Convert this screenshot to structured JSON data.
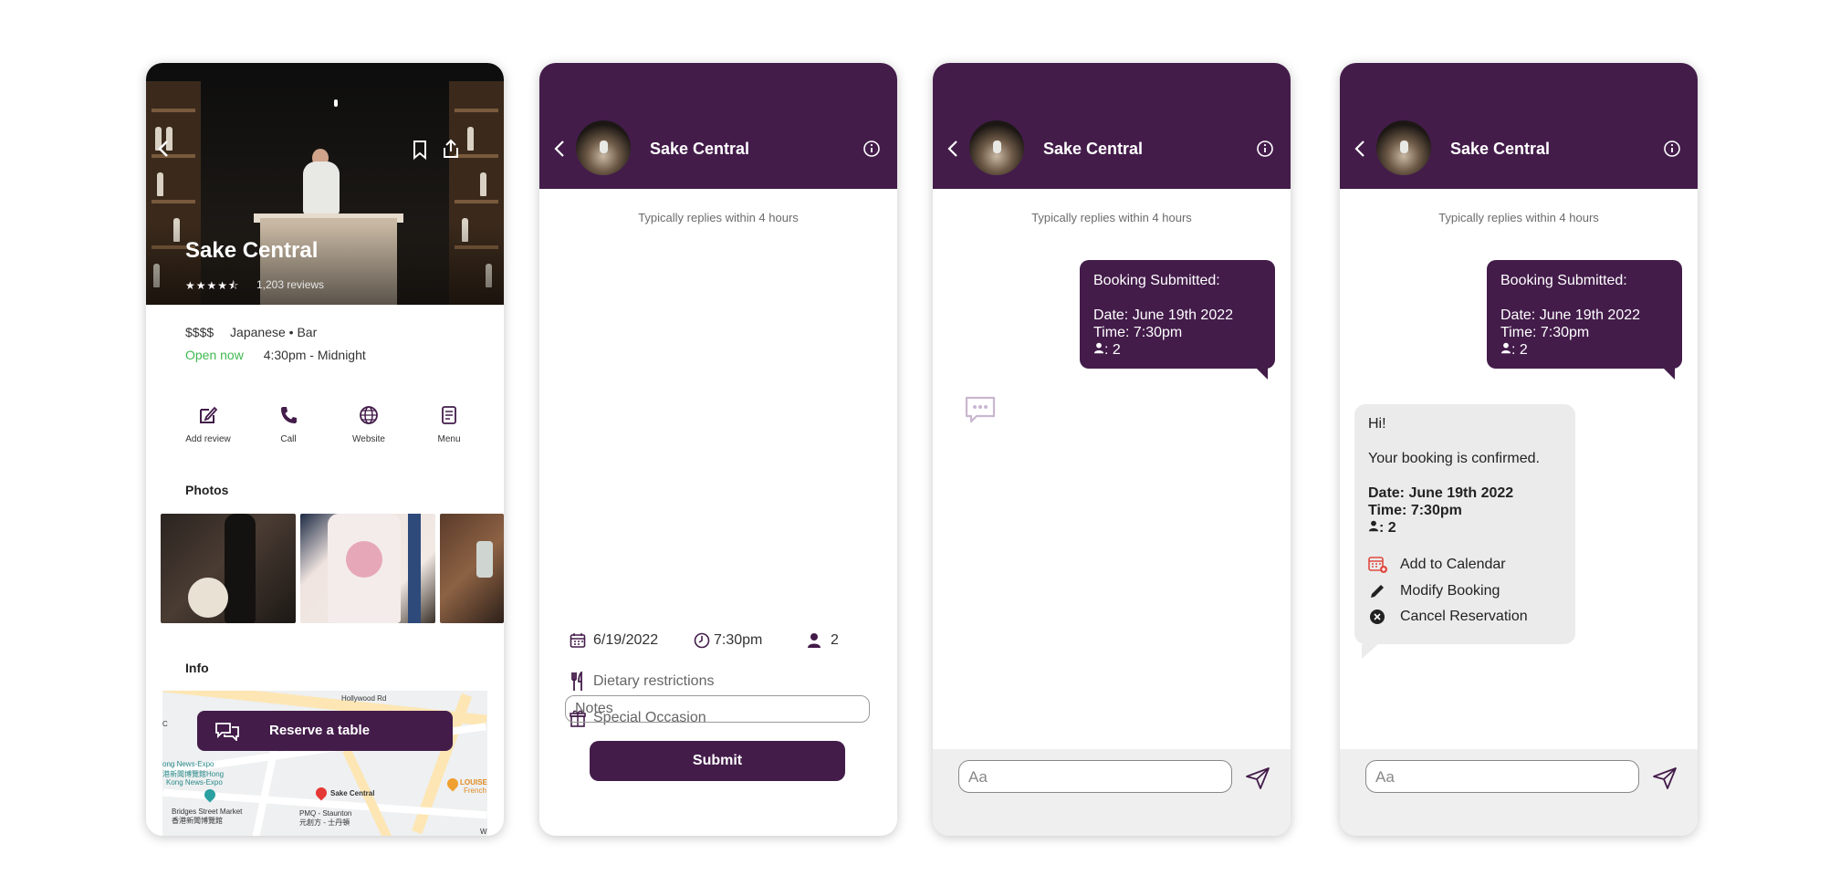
{
  "colors": {
    "brand": "#431c4a",
    "open": "#3fb950",
    "chat_in": "#ebebeb",
    "composer_bg": "#efefef"
  },
  "restaurant": {
    "name": "Sake Central",
    "rating_stars": "★★★★⯪",
    "rating": 4.5,
    "reviews": "1,203 reviews",
    "price": "$$$$",
    "cuisine": "Japanese • Bar",
    "open_status": "Open now",
    "hours": "4:30pm - Midnight"
  },
  "actions": [
    {
      "label": "Add review",
      "icon": "edit-icon"
    },
    {
      "label": "Call",
      "icon": "phone-icon"
    },
    {
      "label": "Website",
      "icon": "globe-icon"
    },
    {
      "label": "Menu",
      "icon": "menu-icon"
    }
  ],
  "sections": {
    "photos": "Photos",
    "info": "Info"
  },
  "map": {
    "labels": {
      "road": "Hollywood Rd",
      "news": "ong News-Expo",
      "news_cn": "港新聞博覽館Hong",
      "news2": "Kong News-Expo",
      "place": "Sake Central",
      "bridges": "Bridges Street Market",
      "bridges_cn": "香港新聞博覽館",
      "pmq": "PMQ - Staunton",
      "pmq_cn": "元創方 - 士丹頓",
      "louise": "LOUISE",
      "louise_sub": "French",
      "edge_c": "C",
      "edge_w": "W"
    }
  },
  "reserve_label": "Reserve a table",
  "chat": {
    "title": "Sake Central",
    "typically": "Typically replies within 4 hours",
    "composer_placeholder": "Aa"
  },
  "form": {
    "date": "6/19/2022",
    "time": "7:30pm",
    "party": "2",
    "dietary": "Dietary restrictions",
    "occasion": "Special Occasion",
    "notes_placeholder": "Notes",
    "submit": "Submit"
  },
  "booking_message": {
    "heading": "Booking Submitted:",
    "date": "Date: June 19th 2022",
    "time": "Time: 7:30pm",
    "party": ": 2"
  },
  "confirmation": {
    "greeting": "Hi!",
    "text": "Your booking is confirmed.",
    "date": "Date: June 19th 2022",
    "time": "Time: 7:30pm",
    "party": ": 2",
    "options": [
      {
        "label": "Add to Calendar",
        "icon": "calendar-icon"
      },
      {
        "label": "Modify Booking",
        "icon": "pencil-icon"
      },
      {
        "label": "Cancel Reservation",
        "icon": "cancel-icon"
      }
    ]
  }
}
